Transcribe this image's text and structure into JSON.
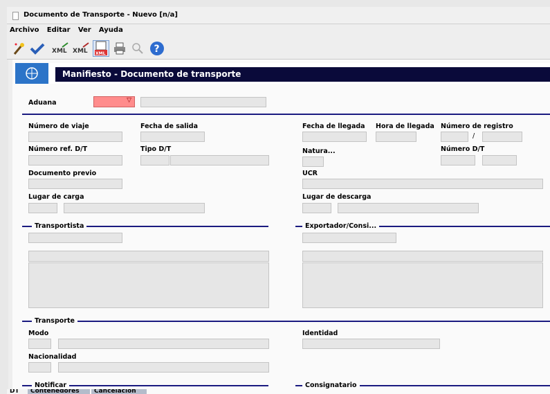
{
  "window": {
    "title": "Documento de Transporte - Nuevo [n/a]"
  },
  "menu": [
    "Archivo",
    "Editar",
    "Ver",
    "Ayuda"
  ],
  "toolbar": {
    "icons": [
      "wand-icon",
      "check-icon",
      "xml-export-icon",
      "xml-import-icon",
      "xml-doc-icon",
      "print-icon",
      "search-icon",
      "help-icon"
    ]
  },
  "header": {
    "title": "Manifiesto - Documento de transporte"
  },
  "form": {
    "aduana": "Aduana",
    "aduana_arrow": "▽",
    "numero_viaje": "Número de viaje",
    "fecha_salida": "Fecha de salida",
    "fecha_llegada": "Fecha de llegada",
    "hora_llegada": "Hora de llegada",
    "numero_registro": "Número de registro",
    "registro_sep": "/",
    "numero_ref": "Número ref. D/T",
    "tipo_dt": "Tipo D/T",
    "natura": "Natura...",
    "numero_dt": "Número D/T",
    "documento_previo": "Documento previo",
    "ucr": "UCR",
    "lugar_carga": "Lugar de carga",
    "lugar_descarga": "Lugar de descarga",
    "transportista": "Transportista",
    "exportador": "Exportador/Consi...",
    "transporte": "Transporte",
    "modo": "Modo",
    "identidad": "Identidad",
    "nacionalidad": "Nacionalidad",
    "notificar": "Notificar",
    "consignatario": "Consignatario"
  },
  "tabs": [
    "DT",
    "Contenedores",
    "Cancelación"
  ],
  "colors": {
    "header_bar": "#0a0a3a",
    "section_line": "#1a1a80",
    "required_field": "#ff8c8c",
    "field_bg": "#e6e6e6"
  }
}
